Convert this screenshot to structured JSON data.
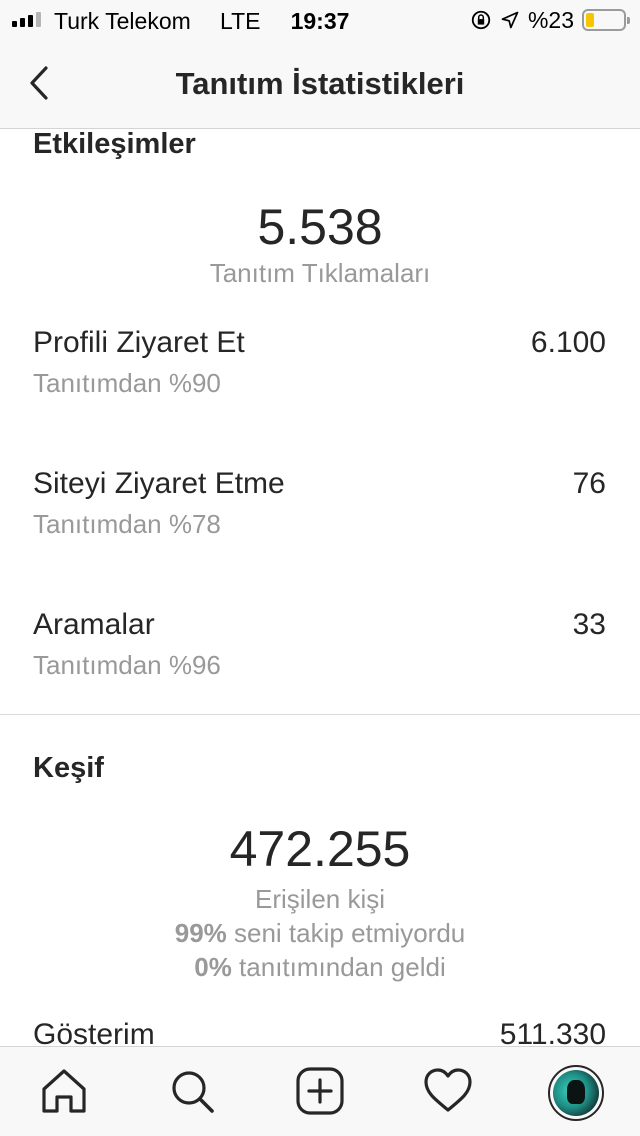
{
  "status_bar": {
    "carrier": "Turk Telekom",
    "network": "LTE",
    "time": "19:37",
    "battery_percent": "%23",
    "battery_level": 0.23,
    "battery_color": "#f5c600"
  },
  "nav": {
    "title": "Tanıtım İstatistikleri",
    "back_icon": "chevron-left-icon"
  },
  "interactions": {
    "title": "Etkileşimler",
    "total_value": "5.538",
    "total_label": "Tanıtım Tıklamaları",
    "rows": [
      {
        "label": "Profili Ziyaret Et",
        "value": "6.100",
        "sub": "Tanıtımdan %90"
      },
      {
        "label": "Siteyi Ziyaret Etme",
        "value": "76",
        "sub": "Tanıtımdan %78"
      },
      {
        "label": "Aramalar",
        "value": "33",
        "sub": "Tanıtımdan %96"
      }
    ]
  },
  "discovery": {
    "title": "Keşif",
    "reach_value": "472.255",
    "reach_label": "Erişilen kişi",
    "not_following_pct": "99%",
    "not_following_text": "seni takip etmiyordu",
    "from_promo_pct": "0%",
    "from_promo_text": "tanıtımından geldi",
    "impressions_label": "Gösterim",
    "impressions_value": "511.330"
  },
  "tab_bar": {
    "items": [
      {
        "icon": "home-icon"
      },
      {
        "icon": "search-icon"
      },
      {
        "icon": "add-post-icon"
      },
      {
        "icon": "heart-icon"
      },
      {
        "icon": "profile-avatar"
      }
    ]
  },
  "colors": {
    "text_primary": "#262626",
    "text_secondary": "#999999",
    "bar_background": "#f8f8f8",
    "divider": "#dbdbdb"
  }
}
